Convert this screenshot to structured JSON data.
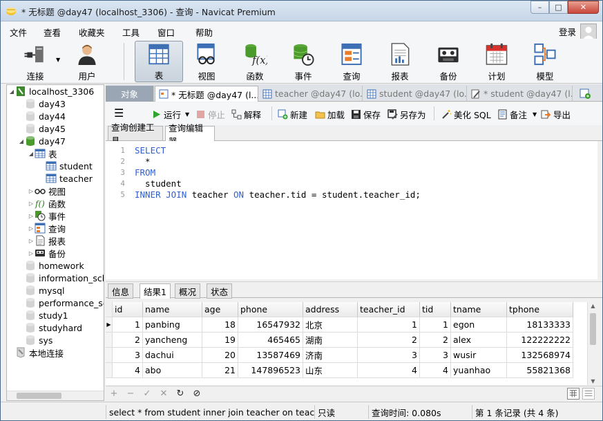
{
  "window": {
    "title": "* 无标题 @day47 (localhost_3306) - 查询 - Navicat Premium",
    "controls": {
      "minimize": "–",
      "maximize": "□",
      "close": "✕"
    }
  },
  "menubar": {
    "items": [
      "文件",
      "查看",
      "收藏夹",
      "工具",
      "窗口",
      "帮助"
    ],
    "login": "登录"
  },
  "toolbar": {
    "buttons": [
      "连接",
      "用户",
      "表",
      "视图",
      "函数",
      "事件",
      "查询",
      "报表",
      "备份",
      "计划",
      "模型"
    ],
    "active": "表"
  },
  "tree": {
    "connection": "localhost_3306",
    "databases_top": [
      "day43",
      "day44",
      "day45",
      "day47"
    ],
    "table_group": "表",
    "tables": [
      "student",
      "teacher"
    ],
    "groups": [
      "视图",
      "函数",
      "事件",
      "查询",
      "报表",
      "备份"
    ],
    "databases_bottom": [
      "homework",
      "information_schema",
      "mysql",
      "performance_schema",
      "study1",
      "studyhard",
      "sys"
    ],
    "local": "本地连接"
  },
  "tabs": [
    "对象",
    "* 无标题 @day47 (l...",
    "teacher @day47 (lo...",
    "student @day47 (lo...",
    "* student @day47 (l..."
  ],
  "query_toolbar": {
    "run": "运行",
    "stop": "停止",
    "explain": "解释",
    "new": "新建",
    "load": "加载",
    "save": "保存",
    "save_as": "另存为",
    "beautify": "美化 SQL",
    "comment": "备注",
    "export": "导出"
  },
  "subtabs": [
    "查询创建工具",
    "查询编辑器"
  ],
  "editor": {
    "lines": [
      {
        "n": "1",
        "parts": [
          {
            "t": "SELECT",
            "kw": true
          }
        ]
      },
      {
        "n": "2",
        "parts": [
          {
            "t": "  *",
            "kw": false
          }
        ]
      },
      {
        "n": "3",
        "parts": [
          {
            "t": "FROM",
            "kw": true
          }
        ]
      },
      {
        "n": "4",
        "parts": [
          {
            "t": "  student",
            "kw": false
          }
        ]
      },
      {
        "n": "5",
        "parts": [
          {
            "t": "INNER JOIN",
            "kw": true
          },
          {
            "t": " teacher ",
            "kw": false
          },
          {
            "t": "ON",
            "kw": true
          },
          {
            "t": " teacher.tid = student.teacher_id;",
            "kw": false
          }
        ]
      }
    ]
  },
  "result_tabs": [
    "信息",
    "结果1",
    "概况",
    "状态"
  ],
  "result": {
    "columns": [
      "id",
      "name",
      "age",
      "phone",
      "address",
      "teacher_id",
      "tid",
      "tname",
      "tphone"
    ],
    "rows": [
      [
        "1",
        "panbing",
        "18",
        "16547932",
        "北京",
        "1",
        "1",
        "egon",
        "18133333"
      ],
      [
        "2",
        "yancheng",
        "19",
        "465465",
        "湖南",
        "2",
        "2",
        "alex",
        "122222222"
      ],
      [
        "3",
        "dachui",
        "20",
        "13587469",
        "济南",
        "3",
        "3",
        "wusir",
        "132568974"
      ],
      [
        "4",
        "abo",
        "21",
        "147896523",
        "山东",
        "4",
        "4",
        "yuanhao",
        "55821368"
      ]
    ]
  },
  "grid_toolbar": [
    "+",
    "−",
    "✓",
    "✕",
    "↻",
    "⊘"
  ],
  "status": {
    "sql": "select * from student inner join teacher on teacher.",
    "mode": "只读",
    "time": "查询时间: 0.080s",
    "record": "第 1 条记录 (共 4 条)"
  }
}
